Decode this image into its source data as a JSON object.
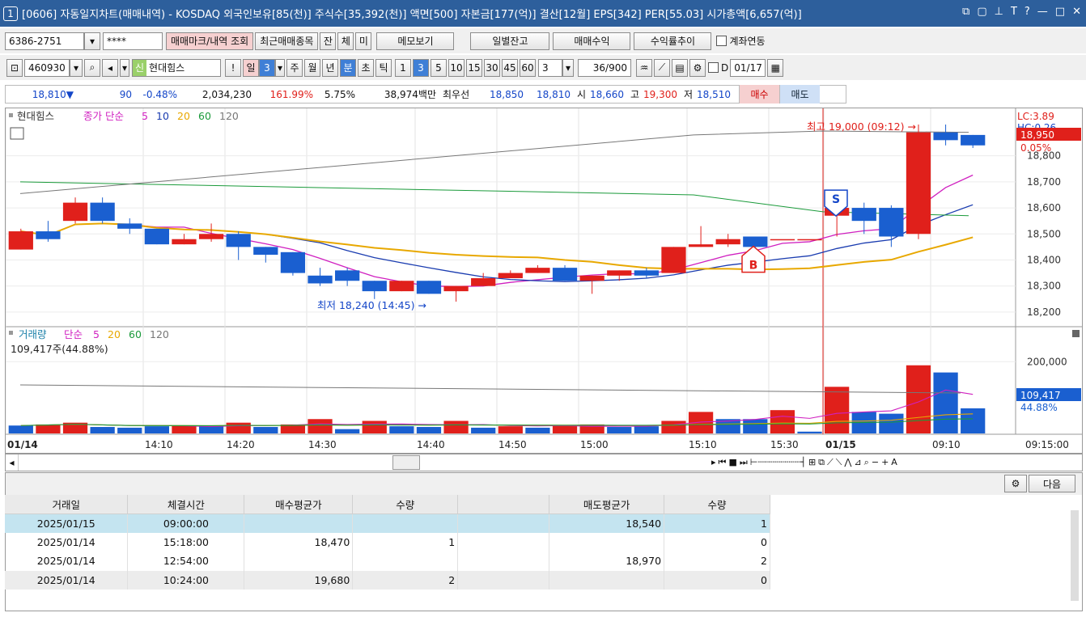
{
  "title": {
    "window_num": "1",
    "text": "[0606] 자동일지차트(매매내역) - KOSDAQ 외국인보유[85(천)] 주식수[35,392(천)] 액면[500] 자본금[177(억)] 결산[12월] EPS[342] PER[55.03] 시가총액[6,657(억)]"
  },
  "toolbar1": {
    "account": "6386-2751",
    "password": "****",
    "query_btn": "매매마크/내역 조회",
    "recent_btn": "최근매매종목",
    "b_jan": "잔",
    "b_che": "체",
    "b_mi": "미",
    "memo_btn": "메모보기",
    "daily_btn": "일별잔고",
    "profit_btn": "매매수익",
    "rate_btn": "수익률추이",
    "link_label": "계좌연동"
  },
  "toolbar2": {
    "code": "460930",
    "credit": "신",
    "stock_name": "현대힘스",
    "periods": [
      "일",
      "3",
      "주",
      "월",
      "년",
      "분",
      "초",
      "틱"
    ],
    "mins": [
      "1",
      "3",
      "5",
      "10",
      "15",
      "30",
      "45",
      "60"
    ],
    "count": "3",
    "view": "36/900",
    "d_label": "D",
    "date": "01/17"
  },
  "quote": {
    "price": "18,810▼",
    "change": "90",
    "rate": "-0.48%",
    "volume": "2,034,230",
    "vol_ratio": "161.99%",
    "turnover": "5.75%",
    "amount": "38,974백만",
    "best_label": "최우선",
    "ask": "18,850",
    "bid": "18,810",
    "open_label": "시",
    "open": "18,660",
    "high_label": "고",
    "high": "19,300",
    "low_label": "저",
    "low": "18,510",
    "buy": "매수",
    "sell": "매도"
  },
  "chart": {
    "price_legend": {
      "name": "현대힘스",
      "series": "종가 단순",
      "ma": [
        "5",
        "10",
        "20",
        "60",
        "120"
      ]
    },
    "vol_legend": {
      "name": "거래량",
      "series": "단순",
      "ma": [
        "5",
        "20",
        "60",
        "120"
      ]
    },
    "vol_value": "109,417주(44.88%)",
    "lc": "LC:3.89",
    "hc": "HC:0.26",
    "cur_price": "18,950",
    "cur_rate": "0.05%",
    "cur_vol": "109,417",
    "cur_vol_rate": "44.88%",
    "high_note": "최고 19,000 (09:12)",
    "low_note": "최저 18,240 (14:45)",
    "sell_mark": "S",
    "buy_mark": "B",
    "y_ticks": [
      "18,800",
      "18,700",
      "18,600",
      "18,500",
      "18,400",
      "18,300",
      "18,200"
    ],
    "vol_ticks": [
      "200,000"
    ],
    "x_ticks": [
      "01/14",
      "14:10",
      "14:20",
      "14:30",
      "14:40",
      "14:50",
      "15:00",
      "15:10",
      "15:30",
      "01/15",
      "09:10",
      "09:15:00"
    ],
    "colors": {
      "up": "#e0201b",
      "down": "#1a5fd0",
      "ma5": "#d020c0",
      "ma10": "#1a3cb0",
      "ma20": "#e8a800",
      "ma60": "#1a9a3a",
      "ma120": "#777777"
    }
  },
  "chart_data": {
    "type": "candlestick",
    "y_range": [
      18150,
      18920
    ],
    "candles": [
      [
        18440,
        18510,
        18520,
        18440
      ],
      [
        18510,
        18480,
        18550,
        18470
      ],
      [
        18550,
        18620,
        18640,
        18540
      ],
      [
        18620,
        18550,
        18640,
        18540
      ],
      [
        18540,
        18520,
        18560,
        18500
      ],
      [
        18520,
        18460,
        18520,
        18460
      ],
      [
        18460,
        18480,
        18500,
        18460
      ],
      [
        18480,
        18500,
        18540,
        18470
      ],
      [
        18500,
        18450,
        18510,
        18400
      ],
      [
        18450,
        18420,
        18450,
        18390
      ],
      [
        18430,
        18350,
        18430,
        18340
      ],
      [
        18340,
        18310,
        18370,
        18300
      ],
      [
        18360,
        18320,
        18370,
        18300
      ],
      [
        18320,
        18280,
        18320,
        18250
      ],
      [
        18280,
        18320,
        18320,
        18280
      ],
      [
        18320,
        18270,
        18320,
        18270
      ],
      [
        18280,
        18300,
        18300,
        18240
      ],
      [
        18300,
        18330,
        18350,
        18300
      ],
      [
        18330,
        18350,
        18360,
        18330
      ],
      [
        18350,
        18370,
        18380,
        18350
      ],
      [
        18370,
        18320,
        18380,
        18320
      ],
      [
        18320,
        18340,
        18340,
        18270
      ],
      [
        18340,
        18360,
        18360,
        18320
      ],
      [
        18360,
        18340,
        18370,
        18330
      ],
      [
        18350,
        18450,
        18450,
        18350
      ],
      [
        18450,
        18460,
        18530,
        18450
      ],
      [
        18460,
        18480,
        18500,
        18450
      ],
      [
        18490,
        18450,
        18490,
        18440
      ],
      [
        18480,
        18480,
        18480,
        18480
      ],
      [
        18480,
        18480,
        18480,
        18480
      ],
      [
        18570,
        18600,
        18620,
        18490
      ],
      [
        18600,
        18550,
        18620,
        18500
      ],
      [
        18600,
        18490,
        18610,
        18450
      ],
      [
        18500,
        18890,
        18920,
        18480
      ],
      [
        18890,
        18860,
        18920,
        18840
      ],
      [
        18880,
        18840,
        18880,
        18830
      ]
    ],
    "volume_max": 230000,
    "volumes": [
      [
        22000,
        "d"
      ],
      [
        25000,
        "u"
      ],
      [
        30000,
        "u"
      ],
      [
        18000,
        "d"
      ],
      [
        16000,
        "d"
      ],
      [
        20000,
        "d"
      ],
      [
        22000,
        "u"
      ],
      [
        20000,
        "d"
      ],
      [
        30000,
        "u"
      ],
      [
        18000,
        "d"
      ],
      [
        25000,
        "u"
      ],
      [
        40000,
        "u"
      ],
      [
        12000,
        "d"
      ],
      [
        35000,
        "u"
      ],
      [
        20000,
        "d"
      ],
      [
        18000,
        "d"
      ],
      [
        35000,
        "u"
      ],
      [
        16000,
        "d"
      ],
      [
        20000,
        "u"
      ],
      [
        16000,
        "d"
      ],
      [
        22000,
        "u"
      ],
      [
        25000,
        "u"
      ],
      [
        18000,
        "d"
      ],
      [
        20000,
        "d"
      ],
      [
        35000,
        "u"
      ],
      [
        60000,
        "u"
      ],
      [
        40000,
        "d"
      ],
      [
        40000,
        "d"
      ],
      [
        65000,
        "u"
      ],
      [
        5000,
        "d"
      ],
      [
        130000,
        "u"
      ],
      [
        60000,
        "d"
      ],
      [
        55000,
        "d"
      ],
      [
        190000,
        "u"
      ],
      [
        170000,
        "d"
      ],
      [
        70000,
        "d"
      ]
    ]
  },
  "table": {
    "headers": [
      "거래일",
      "체결시간",
      "매수평균가",
      "수량",
      "",
      "매도평균가",
      "수량"
    ],
    "rows": [
      [
        "2025/01/15",
        "09:00:00",
        "",
        "",
        "",
        "18,540",
        "1"
      ],
      [
        "2025/01/14",
        "15:18:00",
        "18,470",
        "1",
        "",
        "",
        "0"
      ],
      [
        "2025/01/14",
        "12:54:00",
        "",
        "",
        "",
        "18,970",
        "2"
      ],
      [
        "2025/01/14",
        "10:24:00",
        "19,680",
        "2",
        "",
        "",
        "0"
      ]
    ],
    "next_btn": "다음"
  }
}
